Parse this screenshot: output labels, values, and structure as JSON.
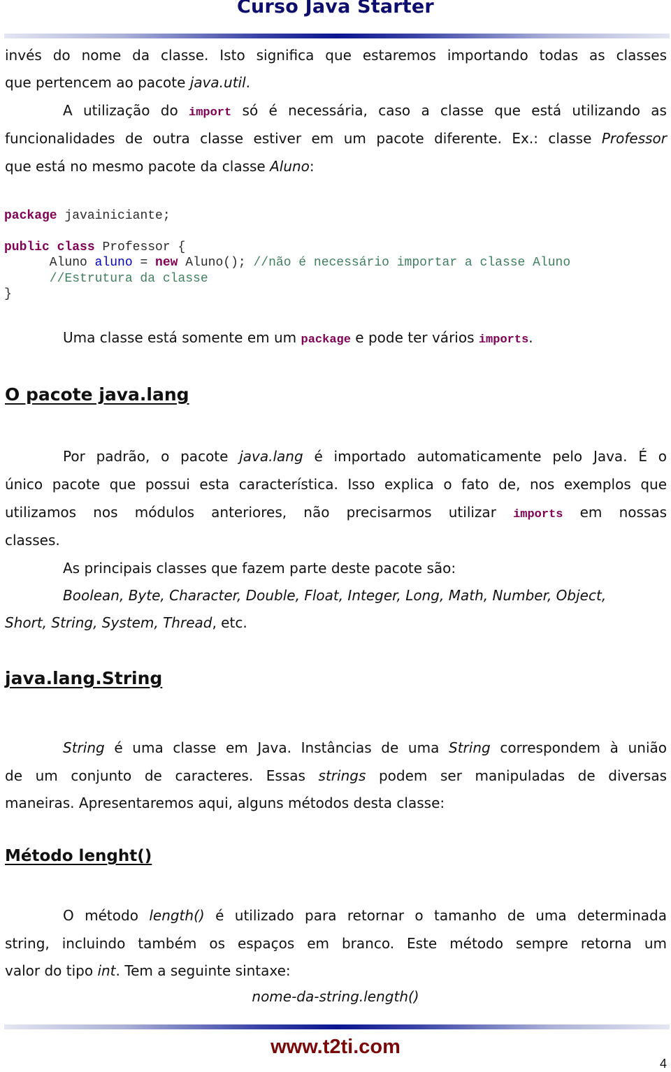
{
  "header": {
    "title": "Curso Java Starter"
  },
  "intro": {
    "line1": "invés do nome da classe. Isto significa que estaremos importando todas as classes",
    "line2_pre": "que pertencem ao pacote ",
    "line2_em": "java.util",
    "line2_post": ".",
    "line3_pre": "A utilização do ",
    "line3_kw": "import",
    "line3_post": " só é necessária, caso a classe que está utilizando as",
    "line4_pre": "funcionalidades de outra classe estiver em um pacote diferente. Ex.: classe ",
    "line4_em": "Professor",
    "line5_pre": "que está no mesmo pacote da classe ",
    "line5_em": "Aluno",
    "line5_post": ":"
  },
  "code": {
    "line1_kw": "package",
    "line1_rest": " javainiciante;",
    "line2_kw1": "public",
    "line2_kw2": "class",
    "line2_rest": " Professor {",
    "line3_type": "      Aluno ",
    "line3_var": "aluno",
    "line3_eq": " = ",
    "line3_kw": "new",
    "line3_rest": " Aluno(); ",
    "line3_comment": "//não é necessário importar a classe Aluno",
    "line4_comment": "      //Estrutura da classe",
    "line5": "}"
  },
  "note": {
    "pre": "Uma classe está somente em um ",
    "kw1": "package",
    "mid": " e pode ter vários ",
    "kw2": "imports",
    "post": "."
  },
  "section_java_lang": {
    "heading": "O pacote java.lang",
    "p1_l1_pre": "Por padrão, o pacote ",
    "p1_l1_em": "java.lang",
    "p1_l1_post": " é importado automaticamente pelo Java. É o",
    "p1_l2": "único pacote que possui esta característica. Isso explica o fato de, nos exemplos que",
    "p1_l3_pre": "utilizamos nos módulos anteriores, não precisarmos utilizar ",
    "p1_l3_kw": "imports",
    "p1_l3_post": " em nossas",
    "p1_l4": "classes.",
    "p2": "As principais classes que fazem parte deste pacote são:",
    "classes_l1": "Boolean, Byte, Character, Double, Float, Integer, Long, Math, Number, Object,",
    "classes_l2": "Short, String, System, Thread",
    "classes_l2_post": ", etc."
  },
  "section_string": {
    "heading": "java.lang.String",
    "l1_em1": "String",
    "l1_mid": " é uma classe em Java. Instâncias de uma ",
    "l1_em2": "String",
    "l1_post": " correspondem à união",
    "l2_pre": "de um conjunto de caracteres. Essas ",
    "l2_em": "strings",
    "l2_post": " podem ser manipuladas de diversas",
    "l3": "maneiras. Apresentaremos aqui, alguns métodos desta classe:"
  },
  "section_length": {
    "heading": "Método lenght()",
    "l1_pre": "O método ",
    "l1_em": "length()",
    "l1_post": " é utilizado para retornar o tamanho de uma determinada",
    "l2": "string, incluindo também os espaços em branco. Este método sempre retorna um",
    "l3_pre": "valor do tipo ",
    "l3_em": "int",
    "l3_post": ". Tem a seguinte sintaxe:",
    "syntax": "nome-da-string.length()"
  },
  "footer": {
    "url": "www.t2ti.com",
    "page": "4"
  }
}
